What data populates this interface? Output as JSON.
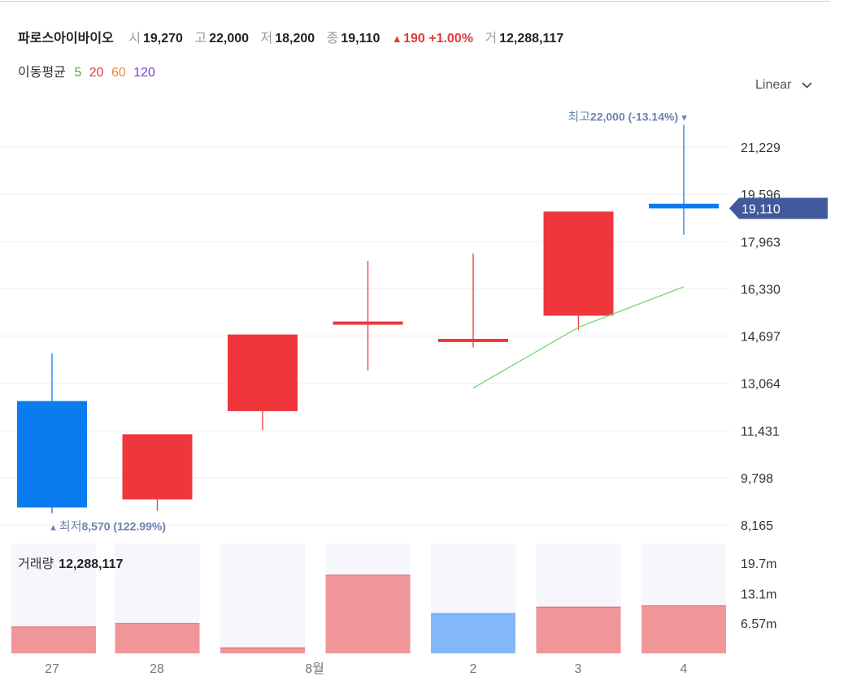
{
  "header": {
    "stock_name": "파로스아이바이오",
    "open_label": "시",
    "open": "19,270",
    "high_label": "고",
    "high": "22,000",
    "low_label": "저",
    "low": "18,200",
    "close_label": "종",
    "close": "19,110",
    "change_arrow": "▲",
    "change": "190",
    "change_pct": "+1.00%",
    "volume_label": "거",
    "volume": "12,288,117"
  },
  "moving_average": {
    "label": "이동평균",
    "periods": [
      {
        "period": "5",
        "color": "#3fae3f"
      },
      {
        "period": "20",
        "color": "#e5383c"
      },
      {
        "period": "60",
        "color": "#e8893a"
      },
      {
        "period": "120",
        "color": "#7b3fd6"
      }
    ]
  },
  "scale_selector": {
    "value": "Linear",
    "icon": "chevron-down-icon"
  },
  "colors": {
    "up": "#ef373b",
    "down": "#0a7cf0",
    "up_volume": "#f09699",
    "down_volume": "#82b8f8",
    "ma5": "#7ad87a",
    "price_tag": "#41599a",
    "annotation": "#6e82ad"
  },
  "price_tag": "19,110",
  "annotations": {
    "high": {
      "label": "최고",
      "value": "22,000 (-13.14%)",
      "marker": "▼"
    },
    "low": {
      "marker": "▲",
      "label": "최저",
      "value": "8,570 (122.99%)"
    }
  },
  "volume_panel": {
    "label": "거래량",
    "value": "12,288,117"
  },
  "chart_data": {
    "type": "candlestick",
    "y_ticks": [
      "21,229",
      "19,596",
      "17,963",
      "16,330",
      "14,697",
      "13,064",
      "11,431",
      "9,798",
      "8,165"
    ],
    "y_tick_values": [
      21229,
      19596,
      17963,
      16330,
      14697,
      13064,
      11431,
      9798,
      8165
    ],
    "ylim": [
      8165,
      22800
    ],
    "x_labels": [
      "27",
      "28",
      "8월",
      "2",
      "3",
      "4"
    ],
    "candles": [
      {
        "open": 12450,
        "high": 14100,
        "low": 8570,
        "close": 8770,
        "direction": "down"
      },
      {
        "open": 9050,
        "high": 11300,
        "low": 8650,
        "close": 11300,
        "direction": "up"
      },
      {
        "open": 12100,
        "high": 14750,
        "low": 11450,
        "close": 14750,
        "direction": "up"
      },
      {
        "open": 15100,
        "high": 17300,
        "low": 13500,
        "close": 15200,
        "direction": "up"
      },
      {
        "open": 14500,
        "high": 17550,
        "low": 14300,
        "close": 14600,
        "direction": "up"
      },
      {
        "open": 15400,
        "high": 19000,
        "low": 14900,
        "close": 19000,
        "direction": "up"
      },
      {
        "open": 19270,
        "high": 22000,
        "low": 18200,
        "close": 19110,
        "direction": "down"
      }
    ],
    "ma5": [
      null,
      null,
      null,
      null,
      12900,
      15000,
      16400
    ],
    "volume": {
      "ticks": [
        "19.7m",
        "13.1m",
        "6.57m"
      ],
      "tick_values": [
        19700000,
        13100000,
        6570000
      ],
      "ylim": [
        0,
        24000000
      ],
      "values": [
        5900000,
        6600000,
        1300000,
        17200000,
        8800000,
        10200000,
        10500000
      ],
      "directions": [
        "up",
        "up",
        "up",
        "up",
        "down",
        "up",
        "up"
      ]
    }
  }
}
